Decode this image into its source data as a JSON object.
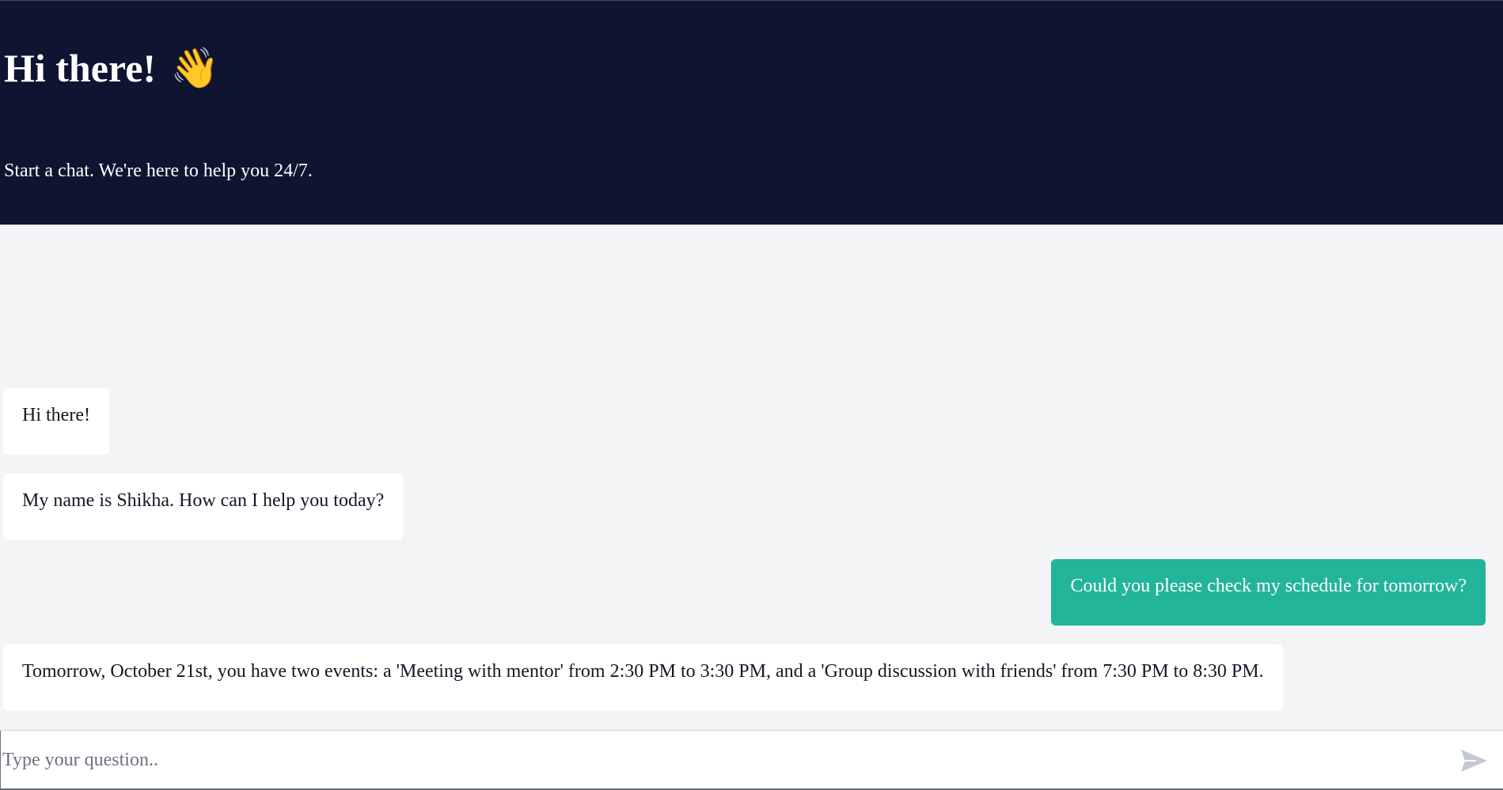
{
  "header": {
    "title": "Hi there!",
    "wave_emoji": "👋",
    "subtitle": "Start a chat. We're here to help you 24/7."
  },
  "messages": [
    {
      "sender": "bot",
      "text": "Hi there!"
    },
    {
      "sender": "bot",
      "text": "My name is Shikha. How can I help you today?"
    },
    {
      "sender": "user",
      "text": "Could you please check my schedule for tomorrow?"
    },
    {
      "sender": "bot",
      "text": "Tomorrow, October 21st, you have two events: a 'Meeting with mentor' from 2:30 PM to 3:30 PM, and a 'Group discussion with friends' from 7:30 PM to 8:30 PM."
    }
  ],
  "composer": {
    "placeholder": "Type your question..",
    "value": "",
    "send_icon": "send-icon"
  },
  "colors": {
    "header_bg": "#0f1431",
    "chat_bg": "#f3f4f6",
    "bot_bubble": "#ffffff",
    "user_bubble": "#22b59a",
    "send_icon": "#c4c8cf"
  }
}
